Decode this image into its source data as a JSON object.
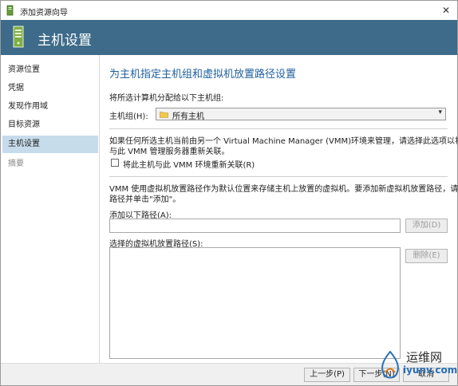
{
  "window": {
    "title": "添加资源向导",
    "close_glyph": "✕"
  },
  "banner": {
    "title": "主机设置"
  },
  "sidebar": {
    "items": [
      {
        "label": "资源位置"
      },
      {
        "label": "凭据"
      },
      {
        "label": "发现作用域"
      },
      {
        "label": "目标资源"
      },
      {
        "label": "主机设置"
      },
      {
        "label": "摘要"
      }
    ]
  },
  "main": {
    "heading": "为主机指定主机组和虚拟机放置路径设置",
    "assign_label": "将所选计算机分配给以下主机组:",
    "host_group_label": "主机组(H):",
    "host_group_value": "所有主机",
    "vmm_info_line1": "如果任何所选主机当前由另一个 Virtual Machine Manager (VMM)环境来管理，请选择此选项以将主机",
    "vmm_info_line2": "与此 VMM 管理服务器重新关联。",
    "reassociate_checkbox_label": "将此主机与此 VMM 环境重新关联(R)",
    "placement_info_line1": "VMM 使用虚拟机放置路径作为默认位置来存储主机上放置的虚拟机。要添加新虚拟机放置路径，请指定",
    "placement_info_line2": "路径并单击\"添加\"。",
    "add_path_label": "添加以下路径(A):",
    "add_path_value": "",
    "add_button": "添加(D)",
    "selected_paths_label": "选择的虚拟机放置路径(S):",
    "remove_button": "删除(E)"
  },
  "footer": {
    "prev_button": "上一步(P)",
    "next_button": "下一步(N)",
    "cancel_button": "取消"
  },
  "watermark": {
    "text1": "运维网",
    "text2": "iyunv.com"
  },
  "colors": {
    "banner": "#3d6b89",
    "heading": "#1f5f9c",
    "sidebar_active": "#c7dceb"
  }
}
